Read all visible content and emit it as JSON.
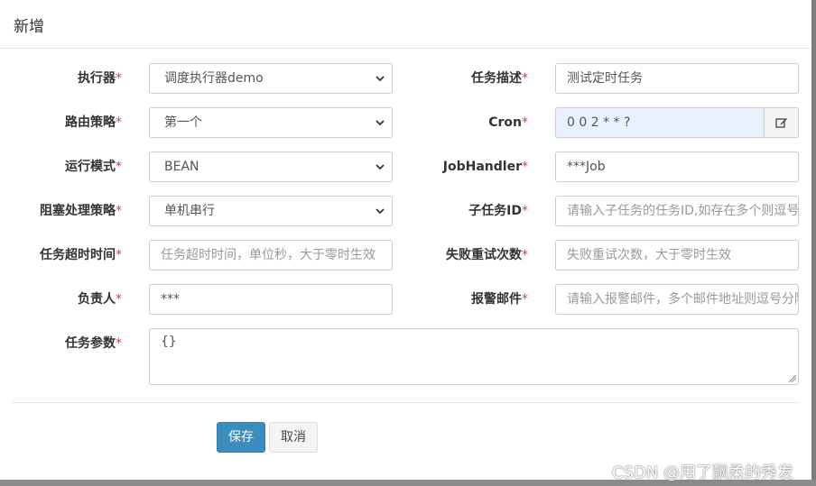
{
  "modal": {
    "title": "新增"
  },
  "form": {
    "executor": {
      "label": "执行器",
      "required": "*",
      "value": "调度执行器demo"
    },
    "job_desc": {
      "label": "任务描述",
      "required": "*",
      "value": "测试定时任务"
    },
    "route_strategy": {
      "label": "路由策略",
      "required": "*",
      "value": "第一个"
    },
    "cron": {
      "label": "Cron",
      "required": "*",
      "value": "0 0 2 * * ?",
      "button_icon": "edit-icon"
    },
    "run_mode": {
      "label": "运行模式",
      "required": "*",
      "value": "BEAN"
    },
    "job_handler": {
      "label": "JobHandler",
      "required": "*",
      "value": "***Job"
    },
    "block_strategy": {
      "label": "阻塞处理策略",
      "required": "*",
      "value": "单机串行"
    },
    "child_job_id": {
      "label": "子任务ID",
      "required": "*",
      "placeholder": "请输入子任务的任务ID,如存在多个则逗号分隔"
    },
    "timeout": {
      "label": "任务超时时间",
      "required": "*",
      "placeholder": "任务超时时间，单位秒，大于零时生效"
    },
    "retry_count": {
      "label": "失败重试次数",
      "required": "*",
      "placeholder": "失败重试次数，大于零时生效"
    },
    "author": {
      "label": "负责人",
      "required": "*",
      "value": "***"
    },
    "alarm_email": {
      "label": "报警邮件",
      "required": "*",
      "placeholder": "请输入报警邮件，多个邮件地址则逗号分隔"
    },
    "job_param": {
      "label": "任务参数",
      "required": "*",
      "value": "{}"
    }
  },
  "actions": {
    "save_label": "保存",
    "cancel_label": "取消"
  },
  "watermark": "CSDN @用了飘柔的秀发",
  "colors": {
    "primary": "#3c8dbc",
    "required": "#e03b3b",
    "autofill": "#e8f0fe"
  }
}
